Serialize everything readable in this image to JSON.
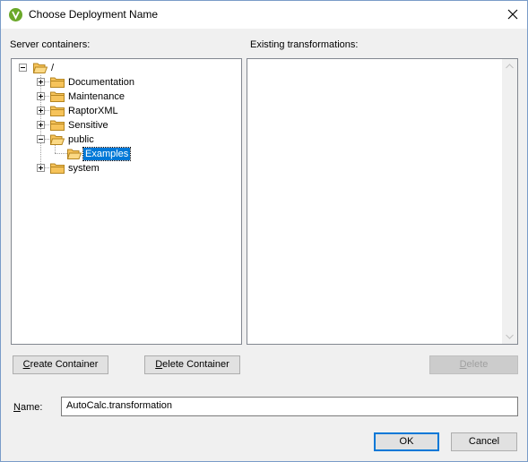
{
  "window": {
    "title": "Choose Deployment Name",
    "app_icon": "altova-app-icon",
    "close_icon": "close-icon"
  },
  "labels": {
    "server_containers": "Server containers:",
    "existing_transformations": "Existing transformations:",
    "name_prefix": "N",
    "name_rest": "ame:"
  },
  "tree": {
    "root": "/",
    "items": [
      {
        "label": "Documentation",
        "expander": "plus"
      },
      {
        "label": "Maintenance",
        "expander": "plus"
      },
      {
        "label": "RaptorXML",
        "expander": "plus"
      },
      {
        "label": "Sensitive",
        "expander": "plus"
      },
      {
        "label": "public",
        "expander": "minus"
      },
      {
        "label": "Examples",
        "selected": true
      },
      {
        "label": "system",
        "expander": "plus"
      }
    ]
  },
  "buttons": {
    "create_container_ul": "C",
    "create_container_rest": "reate Container",
    "delete_container_ul": "D",
    "delete_container_rest": "elete Container",
    "delete_ul": "D",
    "delete_rest": "elete",
    "ok": "OK",
    "cancel": "Cancel"
  },
  "name_field": {
    "value": "AutoCalc.transformation"
  },
  "colors": {
    "selection": "#0078d7",
    "folder_fill": "#f6c35a",
    "folder_stroke": "#b5851f"
  }
}
